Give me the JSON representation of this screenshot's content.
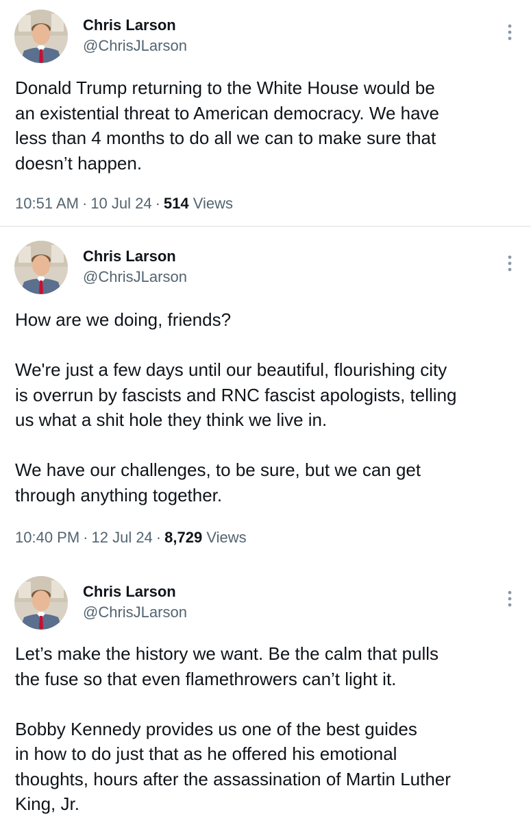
{
  "tweets": [
    {
      "author": {
        "name": "Chris Larson",
        "handle": "@ChrisJLarson"
      },
      "paragraphs": [
        [
          "Donald Trump returning to the White House would be",
          "an existential threat to American democracy. We have",
          "less than 4 months to do all we can to make sure that",
          "doesn’t happen."
        ]
      ],
      "time": "10:51 AM",
      "date": "10 Jul 24",
      "views_count": "514",
      "views_label": "Views"
    },
    {
      "author": {
        "name": "Chris Larson",
        "handle": "@ChrisJLarson"
      },
      "paragraphs": [
        [
          "How are we doing, friends?"
        ],
        [
          "We're just a few days until our beautiful, flourishing city",
          "is overrun by fascists and RNC fascist apologists, telling",
          "us what a shit hole they think we live in."
        ],
        [
          "We have our challenges, to be sure, but we can get",
          "through anything together."
        ]
      ],
      "time": "10:40 PM",
      "date": "12 Jul 24",
      "views_count": "8,729",
      "views_label": "Views"
    },
    {
      "author": {
        "name": "Chris Larson",
        "handle": "@ChrisJLarson"
      },
      "paragraphs": [
        [
          "Let’s make the history we want. Be the calm that pulls",
          "the fuse so that even flamethrowers can’t light it."
        ],
        [
          "Bobby Kennedy provides us one of the best guides",
          "in how to do just that as he offered his emotional",
          "thoughts, hours after the assassination of Martin Luther",
          "King, Jr."
        ]
      ]
    }
  ],
  "meta_separator": "·",
  "icons": {
    "avatar": "profile-photo",
    "more": "more-vertical-icon"
  },
  "colors": {
    "text": "#0f1419",
    "secondary": "#536471",
    "divider": "#eceef0",
    "tie": "#c8102e"
  }
}
